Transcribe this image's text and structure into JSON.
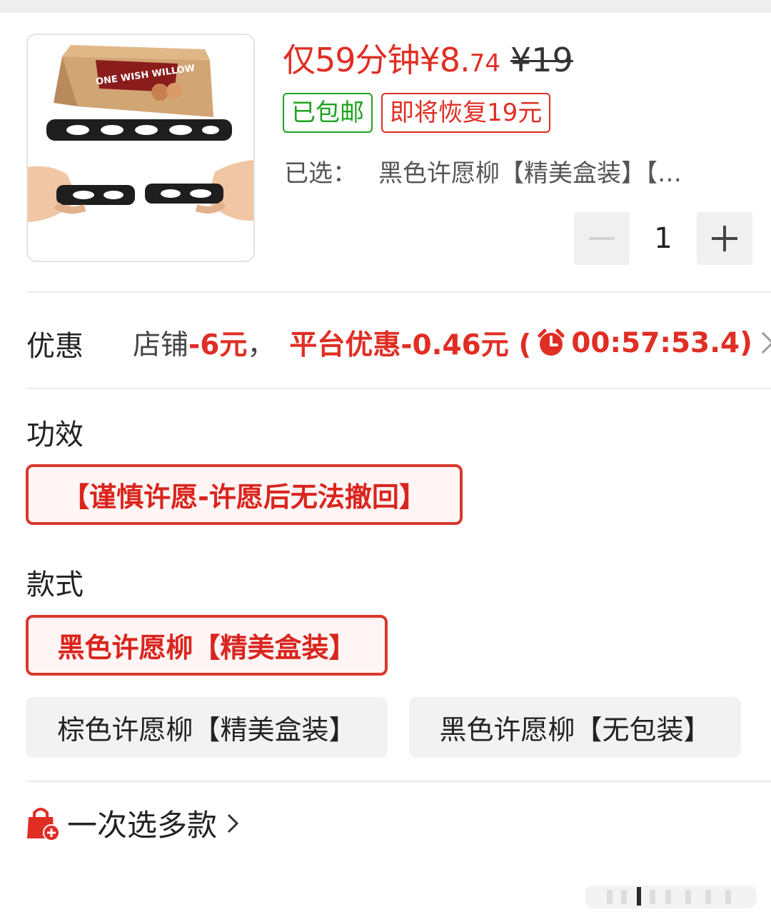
{
  "product": {
    "image_label": "ONE WISH WILLOW",
    "price_main": "仅59分钟¥8.",
    "price_cents": "74",
    "original_price": "¥19",
    "tag_shipping": "已包邮",
    "tag_restore": "即将恢复19元",
    "selected_label": "已选：",
    "selected_value": "黑色许愿柳【精美盒装】【…",
    "quantity": "1"
  },
  "promo": {
    "label": "优惠",
    "shop_prefix": "店铺",
    "shop_amount": "-6元",
    "comma": "，",
    "platform": "平台优惠-0.46元 (",
    "countdown": "00:57:53.4)"
  },
  "effect": {
    "label": "功效",
    "options": [
      "【谨慎许愿-许愿后无法撤回】"
    ]
  },
  "style": {
    "label": "款式",
    "options": [
      "黑色许愿柳【精美盒装】",
      "棕色许愿柳【精美盒装】",
      "黑色许愿柳【无包装】"
    ]
  },
  "multi_select": {
    "label": "一次选多款"
  },
  "colors": {
    "accent": "#e02e24",
    "green": "#1fa31f"
  }
}
